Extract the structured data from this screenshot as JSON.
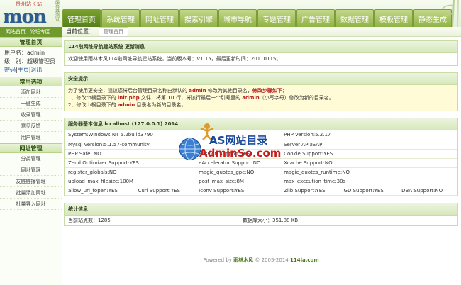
{
  "header": {
    "site_tag": "贵州站长站",
    "logo_text": "mon",
    "logo_vertical": "服务器测试",
    "nav": [
      "管理首页",
      "系统管理",
      "网址管理",
      "搜索引擎",
      "城市导航",
      "专题管理",
      "广告管理",
      "数据管理",
      "模板管理",
      "静态生成"
    ],
    "active_nav": 0
  },
  "infobar": {
    "text": "网站首页 · 论坛专区"
  },
  "crumb": {
    "label": "当前位置：",
    "current": "管理首页"
  },
  "sidebar": {
    "head_home": "管理首页",
    "user_line": "用户名：admin",
    "level_line": "级　别：超级管理员",
    "links": [
      "密码",
      "主页",
      "退出"
    ],
    "sections": [
      {
        "title": "常用选项",
        "items": [
          "添加网址",
          "一键生成",
          "收录管理",
          "意见反馈",
          "用户管理"
        ]
      },
      {
        "title": "网址管理",
        "items": [
          "分类管理",
          "网址管理",
          "友链链接管理",
          "批量添加网址",
          "批量导入网址"
        ]
      }
    ]
  },
  "main": {
    "welcome": {
      "title": "114啦网址导航建站系统 更新消息",
      "text": "欢迎使用雨林木风114啦网址导航建站系统，当前版本号：V1.15，最后更新时间：20110115。"
    },
    "security": {
      "title": "安全提示",
      "line1_pre": "为了使用更安全，建议您将后台管理目录名称由默认的 ",
      "line1_admin": "admin",
      "line1_mid": " 修改为其他目录名，",
      "line1_bold": "修改步骤如下：",
      "line2_pre": "1、修改tb根目录下的 ",
      "line2_file": "init.php",
      "line2_mid": " 文件，将第 ",
      "line2_row": "10",
      "line2_mid2": " 行，将该行最后一个引号里的 ",
      "line2_admin": "admin",
      "line2_post": "（小写字母）修改为新的目录名。",
      "line3_pre": "2、修改tb根目录下的 ",
      "line3_admin": "admin",
      "line3_post": " 目录名为新的目录名。"
    },
    "server": {
      "title": "服务器基本信息 localhost (127.0.0.1)  2014",
      "rows": [
        [
          "System:Windows NT 5.2build3790",
          "",
          "",
          "PHP Version:5.2.17",
          ""
        ],
        [
          "Mysql Version:5.1.57-community",
          "",
          "",
          "Server API:ISAPI",
          ""
        ],
        [
          "PHP Safe: NO",
          "",
          "Session Support:YES",
          "Cookie Support:YES",
          ""
        ],
        [
          "Zend Optimizer Support:YES",
          "",
          "eAccelerator Support:NO",
          "Xcache Support:NO",
          ""
        ],
        [
          "register_globals:NO",
          "",
          "magic_quotes_gpc:NO",
          "magic_quotes_runtime:NO",
          ""
        ],
        [
          "upload_max_filesize:100M",
          "",
          "post_max_size:8M",
          "max_execution_time:30s",
          ""
        ],
        [
          "allow_url_fopen:YES",
          "Curl Support:YES",
          "Iconv Support:YES",
          "Zlib Support:YES",
          "GD Support:YES",
          "DBA Support:NO"
        ]
      ]
    },
    "stats": {
      "title": "统计信息",
      "sites_label": "当前站点数：1285",
      "db_label": "数据库大小：351.88 KB"
    }
  },
  "footer": {
    "prefix": "Powered by ",
    "author": "雨林木风",
    "copy": " © 2005-2014 ",
    "site": "114la.com"
  },
  "watermark": {
    "line1": "AS网站目录",
    "line2": "AdminSo.com"
  },
  "colors": {
    "nav_active": "#5a851c",
    "nav_tab": "#a3c45c",
    "panel_head": "#dbe9c3",
    "warn_bg": "#fffbd6",
    "accent_red": "#b32020"
  }
}
